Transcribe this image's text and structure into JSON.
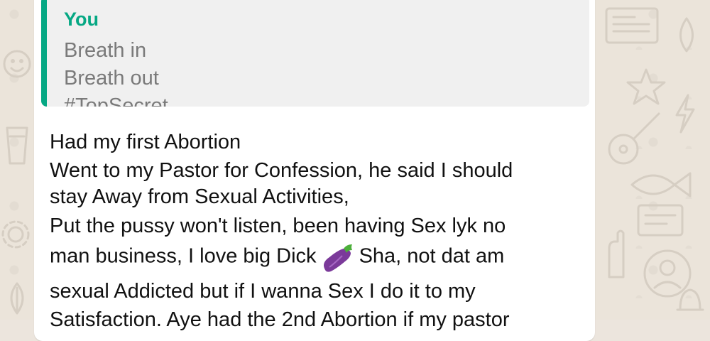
{
  "quote": {
    "author": "You",
    "lines": [
      "Breath in",
      "Breath out",
      "#TopSecret..."
    ]
  },
  "message": {
    "lines": [
      "Had my first Abortion",
      "Went to my Pastor for Confession, he said I should",
      "stay Away from Sexual Activities,",
      "Put the pussy won't listen, been having Sex lyk no",
      "man business, I love big Dick",
      "Sha, not dat am",
      "sexual Addicted but if I wanna Sex I do it to my",
      "Satisfaction. Aye had the 2nd Abortion if my pastor"
    ],
    "emoji": "eggplant-emoji"
  },
  "colors": {
    "accent": "#06a884",
    "wallpaper": "#ece5dd",
    "bubble": "#ffffff",
    "quote_bg": "#f0f0f0"
  }
}
